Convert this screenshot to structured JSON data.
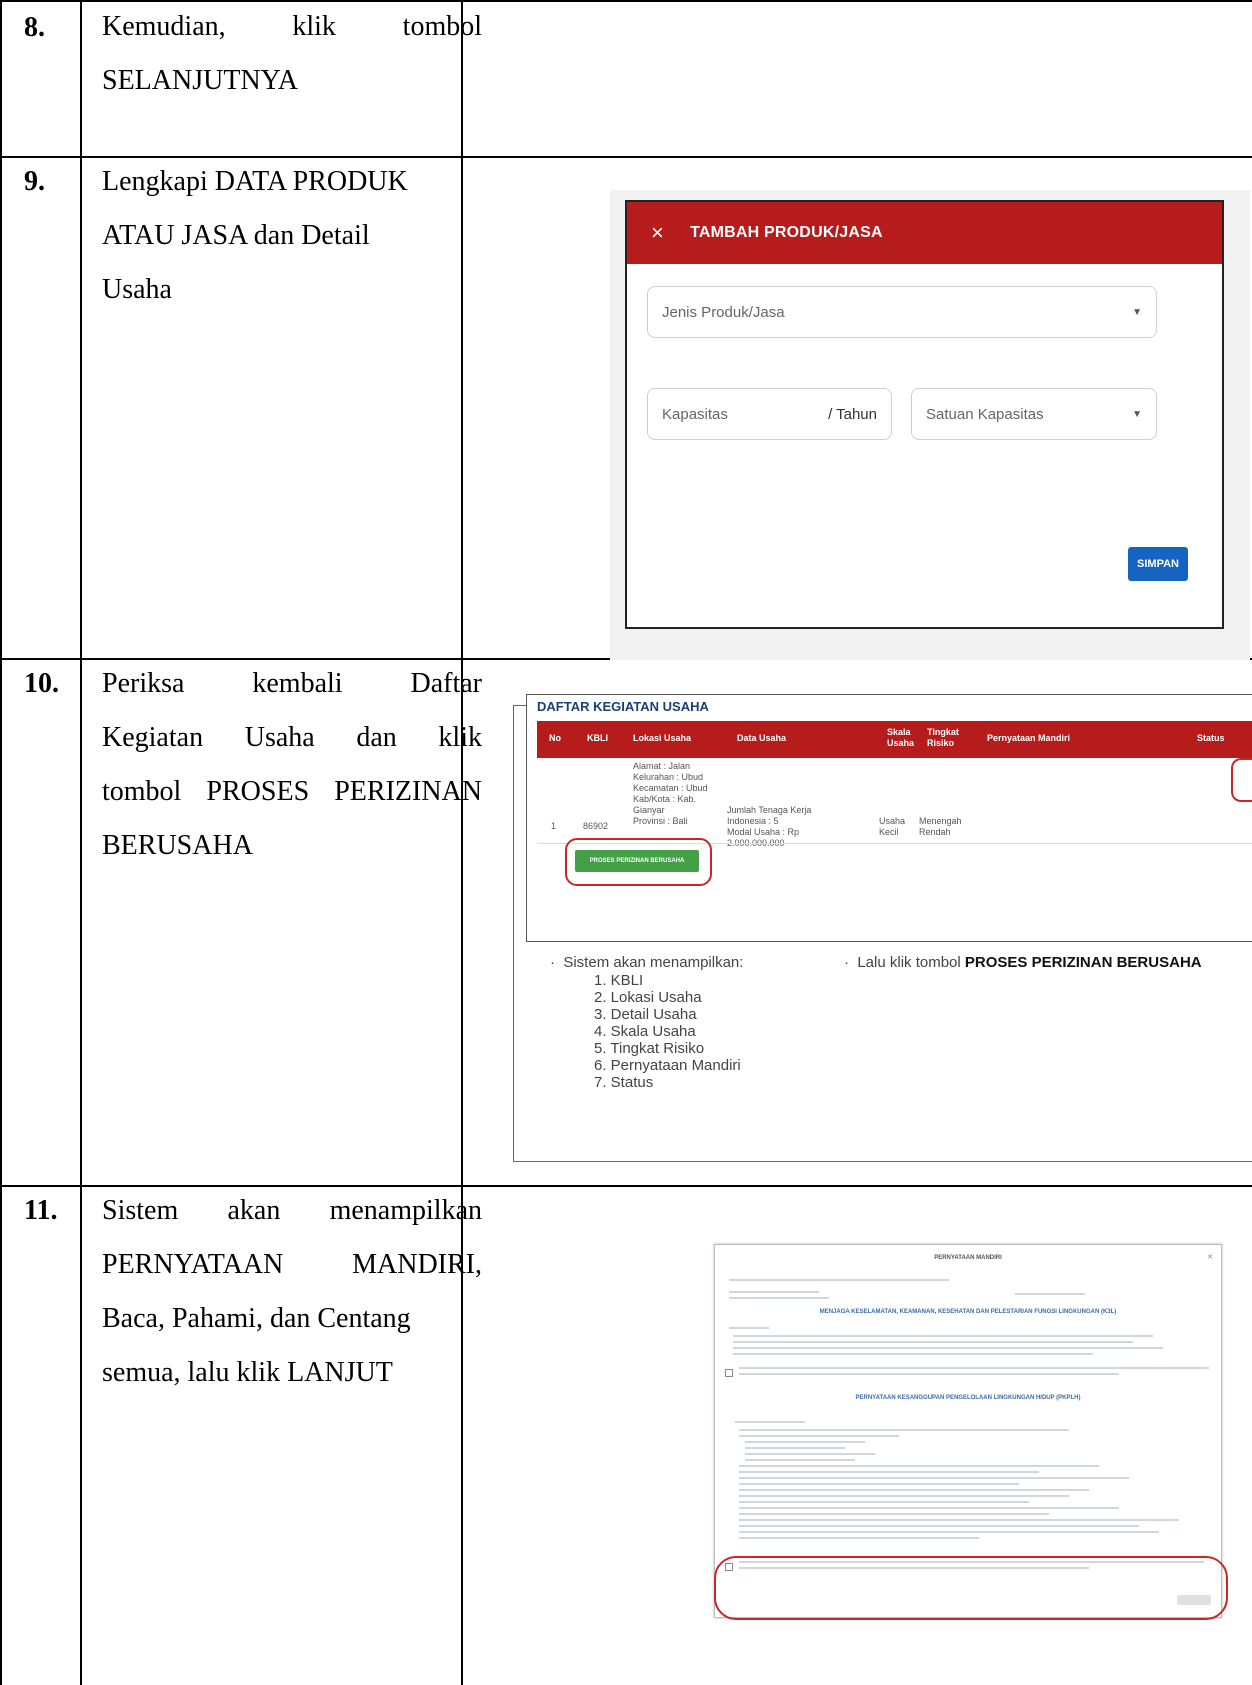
{
  "rows": [
    {
      "number": "8.",
      "desc_lines": [
        "Kemudian,   klik   tombol",
        "SELANJUTNYA"
      ]
    },
    {
      "number": "9.",
      "desc_lines": [
        "Lengkapi DATA PRODUK",
        "ATAU JASA dan Detail",
        "Usaha"
      ],
      "dialog": {
        "title": "TAMBAH PRODUK/JASA",
        "close_icon": "×",
        "field_jenis": "Jenis Produk/Jasa",
        "field_kapasitas": "Kapasitas",
        "field_kapasitas_suffix": "/ Tahun",
        "field_satuan": "Satuan Kapasitas",
        "button": "SIMPAN"
      }
    },
    {
      "number": "10.",
      "desc_lines": [
        "Periksa      kembali      Daftar",
        "Kegiatan   Usaha   dan   klik",
        "tombol PROSES PERIZINAN",
        "BERUSAHA"
      ],
      "screen": {
        "title": "DAFTAR KEGIATAN USAHA",
        "headers": [
          "No",
          "KBLI",
          "Lokasi Usaha",
          "Data Usaha",
          "Skala Usaha",
          "Tingkat Risiko",
          "Pernyataan Mandiri",
          "Status"
        ],
        "row_no": "1",
        "row_kbli": "86902",
        "row_lokasi": [
          "Alamat : Jalan",
          "Kelurahan : Ubud",
          "Kecamatan : Ubud",
          "Kab/Kota : Kab.",
          "Gianyar",
          "Provinsi : Bali"
        ],
        "row_data": [
          "Jumlah Tenaga Kerja",
          "Indonesia : 5",
          "Modal Usaha : Rp",
          "2.000.000.000"
        ],
        "row_skala": [
          "Usaha",
          "Kecil"
        ],
        "row_risiko": [
          "Menengah",
          "Rendah"
        ],
        "button": "PROSES PERIZINAN BERUSAHA",
        "sistem_label": "Sistem akan menampilkan:",
        "sistem_items": [
          "1.  KBLI",
          "2.  Lokasi Usaha",
          "3.  Detail Usaha",
          "4.  Skala Usaha",
          "5.  Tingkat Risiko",
          "6.  Pernyataan Mandiri",
          "7.  Status"
        ],
        "lalu_prefix": "Lalu klik tombol ",
        "lalu_bold": "PROSES PERIZINAN BERUSAHA"
      }
    },
    {
      "number": "11.",
      "desc_lines": [
        "Sistem     akan     menampilkan",
        "PERNYATAAN     MANDIRI,",
        "Baca, Pahami, dan Centang",
        "semua, lalu klik LANJUT"
      ],
      "screen": {
        "title": "PERNYATAAN MANDIRI",
        "heading1": "MENJAGA KESELAMATAN, KEAMANAN, KESEHATAN DAN PELESTARIAN FUNGSI LINGKUNGAN (K3L)",
        "heading2": "PERNYATAAN KESANGGUPAN PENGELOLAAN LINGKUNGAN HIDUP (PKPLH)"
      }
    }
  ]
}
